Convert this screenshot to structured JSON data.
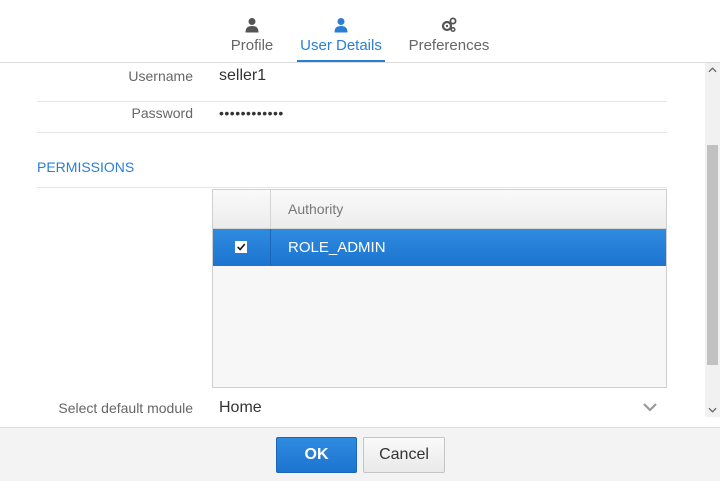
{
  "tabs": [
    {
      "label": "Profile",
      "icon": "user-icon",
      "active": false
    },
    {
      "label": "User Details",
      "icon": "user-icon",
      "active": true
    },
    {
      "label": "Preferences",
      "icon": "gears-icon",
      "active": false
    }
  ],
  "form": {
    "username": {
      "label": "Username",
      "value": "seller1"
    },
    "password": {
      "label": "Password",
      "value": "••••••••••••"
    },
    "permissions_title": "PERMISSIONS",
    "module": {
      "label": "Select default module",
      "value": "Home"
    }
  },
  "permissions_grid": {
    "column_header": "Authority",
    "rows": [
      {
        "authority": "ROLE_ADMIN",
        "checked": true,
        "selected": true
      }
    ]
  },
  "footer": {
    "ok_label": "OK",
    "cancel_label": "Cancel"
  },
  "colors": {
    "accent": "#2a7fd4",
    "selected_row": "#1f78d1"
  }
}
